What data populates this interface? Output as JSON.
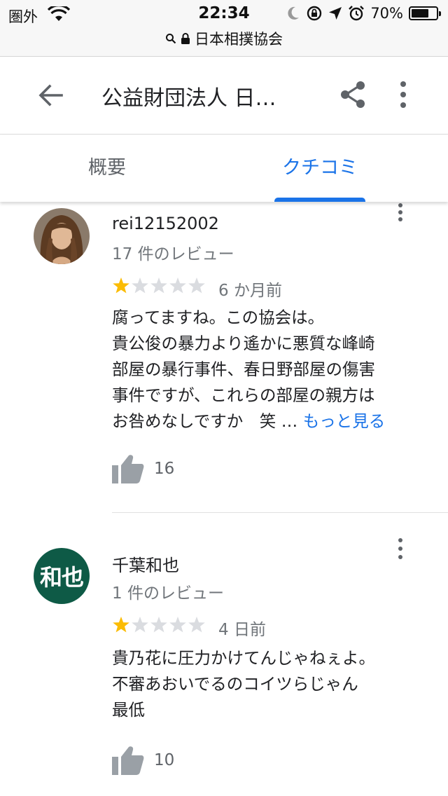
{
  "status": {
    "carrier": "圏外",
    "time": "22:34",
    "battery": "70%",
    "battery_level": 0.7,
    "url": "日本相撲協会"
  },
  "appbar": {
    "title": "公益財団法人 日…",
    "back_icon": "arrow-back-icon",
    "share_icon": "share-icon",
    "more_icon": "more-vert-icon"
  },
  "tabs": [
    {
      "label": "概要",
      "active": false
    },
    {
      "label": "クチコミ",
      "active": true
    }
  ],
  "colors": {
    "accent": "#1a73e8",
    "star_filled": "#fbbc04",
    "star_empty": "#dadce0",
    "avatar_bg": "#0e5a46"
  },
  "reviews": [
    {
      "name": "rei12152002",
      "review_count": "17 件のレビュー",
      "rating": 1,
      "time": "6 か月前",
      "text_lines": [
        "腐ってますね。この協会は。",
        "貴公俊の暴力より遙かに悪質な峰崎",
        "部屋の暴行事件、春日野部屋の傷害",
        "事件ですが、これらの部屋の親方は",
        "お咎めなしですか　笑 …"
      ],
      "more_label": "もっと見る",
      "likes": "16",
      "avatar_type": "photo"
    },
    {
      "name": "千葉和也",
      "review_count": "1 件のレビュー",
      "rating": 1,
      "time": "4 日前",
      "avatar_initials": "和也",
      "text_lines": [
        "貴乃花に圧力かけてんじゃねぇよ。",
        "不審あおいでるのコイツらじゃん",
        "最低"
      ],
      "likes": "10",
      "avatar_type": "initials"
    }
  ]
}
